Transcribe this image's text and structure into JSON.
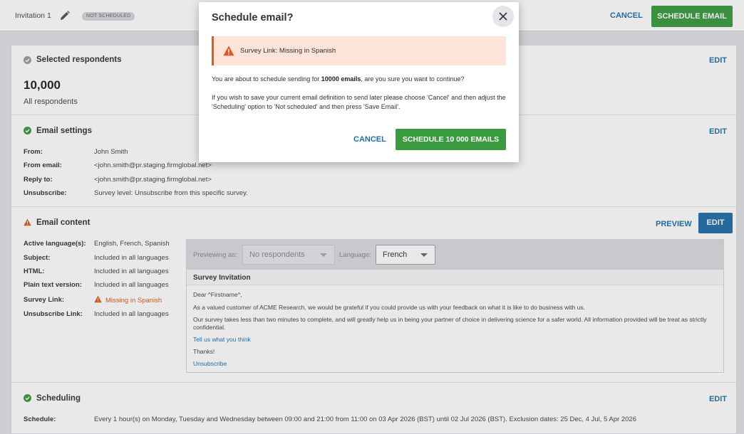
{
  "topbar": {
    "title": "Invitation 1",
    "status_badge": "NOT SCHEDULED",
    "cancel_label": "CANCEL",
    "schedule_label": "SCHEDULE EMAIL"
  },
  "colors": {
    "primary_blue": "#1f6fa8",
    "success_green": "#3a9a3e",
    "warning_orange": "#e05a1e",
    "alert_bg": "#fde3d8"
  },
  "respondents": {
    "title": "Selected respondents",
    "edit_label": "EDIT",
    "count": "10,000",
    "description": "All respondents"
  },
  "email_settings": {
    "title": "Email settings",
    "edit_label": "EDIT",
    "rows": [
      {
        "label": "From:",
        "value": "John Smith"
      },
      {
        "label": "From email:",
        "value": "<john.smith@pr.staging.firmglobal.net>"
      },
      {
        "label": "Reply to:",
        "value": "<john.smith@pr.staging.firmglobal.net>"
      },
      {
        "label": "Unsubscribe:",
        "value": "Survey level: Unsubscribe from this specific survey."
      }
    ]
  },
  "email_content": {
    "title": "Email content",
    "preview_label": "PREVIEW",
    "edit_label": "EDIT",
    "rows": [
      {
        "label": "Active language(s):",
        "value": "English, French, Spanish"
      },
      {
        "label": "Subject:",
        "value": "Included in all languages"
      },
      {
        "label": "HTML:",
        "value": "Included in all languages"
      },
      {
        "label": "Plain text version:",
        "value": "Included in all languages"
      },
      {
        "label": "Survey Link:",
        "value": "Missing in Spanish"
      },
      {
        "label": "Unsubscribe Link:",
        "value": "Included in all languages"
      }
    ],
    "preview": {
      "previewing_as_label": "Previewing as:",
      "previewing_as_value": "No respondents",
      "language_label": "Language:",
      "language_value": "French",
      "heading": "Survey Invitation",
      "greeting": "Dear ^Firstname^,",
      "paragraph1": "As a valued customer of ACME Research, we would be grateful if you could provide us with your feedback on what it is like to do business with us.",
      "paragraph2": "Our survey takes less than two minutes to complete, and will greatly help us in being your partner of choice in delivering science for a safer world. All information provided will be treat as strictly confidential.",
      "link_text": "Tell us what you think",
      "thanks": "Thanks!",
      "unsubscribe_text": "Unsubscribe"
    }
  },
  "scheduling": {
    "title": "Scheduling",
    "edit_label": "EDIT",
    "label": "Schedule:",
    "value": "Every 1 hour(s) on Monday, Tuesday and Wednesday between 09:00 and 21:00 from 11:00 on 03 Apr 2026 (BST) until 02 Jul 2026 (BST). Exclusion dates: 25 Dec, 4 Jul, 5 Apr 2026"
  },
  "modal": {
    "title": "Schedule email?",
    "alert_text": "Survey Link: Missing in Spanish",
    "message_pre": "You are about to schedule sending for ",
    "message_bold": "10000 emails",
    "message_post": ", are you sure you want to continue?",
    "message2": "If you wish to save your current email definition to send later please choose 'Cancel' and then adjust the 'Scheduling' option to 'Not scheduled' and then press 'Save Email'.",
    "cancel_label": "CANCEL",
    "confirm_label": "SCHEDULE 10 000 EMAILS"
  }
}
